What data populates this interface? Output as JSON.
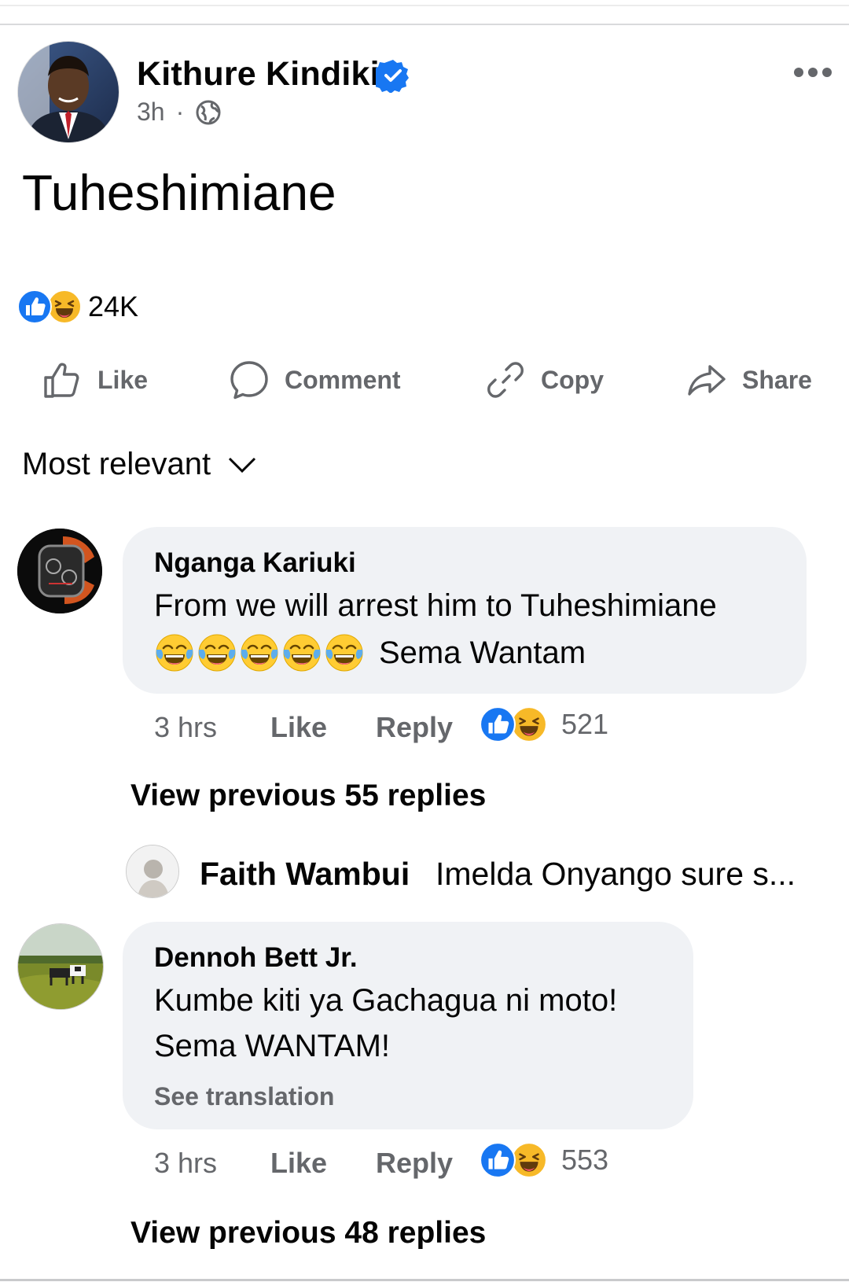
{
  "post": {
    "author": "Kithure Kindiki",
    "verified": true,
    "time": "3h",
    "separator": "·",
    "audience_icon": "globe-icon",
    "text": "Tuheshimiane",
    "reaction_icons": [
      "like-reaction-icon",
      "haha-reaction-icon"
    ],
    "reaction_count": "24K"
  },
  "actions": {
    "like": "Like",
    "comment": "Comment",
    "copy": "Copy",
    "share": "Share"
  },
  "sort": {
    "label": "Most relevant"
  },
  "comments": [
    {
      "author": "Nganga Kariuki",
      "line1": "From we will arrest him to Tuheshimiane",
      "emoji_count": 5,
      "line2": "Sema Wantam",
      "time": "3 hrs",
      "like_label": "Like",
      "reply_label": "Reply",
      "reaction_count": "521",
      "view_replies": "View previous 55 replies",
      "reply_preview": {
        "author": "Faith Wambui",
        "text": "Imelda Onyango sure s..."
      }
    },
    {
      "author": "Dennoh Bett Jr.",
      "line1": "Kumbe kiti ya Gachagua ni moto!",
      "line2": "Sema WANTAM!",
      "see_translation": "See translation",
      "time": "3 hrs",
      "like_label": "Like",
      "reply_label": "Reply",
      "reaction_count": "553",
      "view_replies": "View previous 48 replies"
    }
  ],
  "colors": {
    "facebook_blue": "#1877f2",
    "secondary_text": "#65676b",
    "bubble_bg": "#f0f2f5",
    "haha_yellow": "#f7b928"
  }
}
